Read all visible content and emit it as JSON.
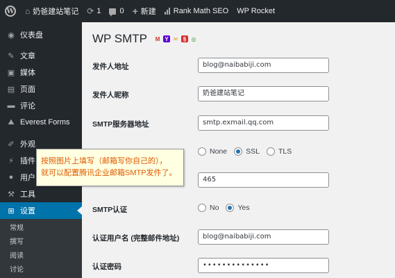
{
  "adminbar": {
    "site_name": "奶爸建站笔记",
    "updates_count": "1",
    "comments_count": "0",
    "new_label": "新建",
    "rank_math": "Rank Math SEO",
    "wp_rocket": "WP Rocket"
  },
  "sidebar": {
    "items": [
      {
        "label": "仪表盘",
        "icon": "dashboard-icon"
      },
      {
        "label": "文章",
        "icon": "pin-icon"
      },
      {
        "label": "媒体",
        "icon": "media-icon"
      },
      {
        "label": "页面",
        "icon": "page-icon"
      },
      {
        "label": "评论",
        "icon": "comment-icon"
      },
      {
        "label": "Everest Forms",
        "icon": "everest-icon"
      },
      {
        "label": "外观",
        "icon": "brush-icon"
      },
      {
        "label": "插件",
        "icon": "plugin-icon"
      },
      {
        "label": "用户",
        "icon": "user-icon"
      },
      {
        "label": "工具",
        "icon": "wrench-icon"
      },
      {
        "label": "设置",
        "icon": "settings-icon"
      }
    ],
    "submenu": [
      "常规",
      "撰写",
      "阅读",
      "讨论"
    ]
  },
  "page": {
    "title": "WP SMTP",
    "title_icons": [
      "M",
      "Y",
      "✉",
      "§",
      "◎"
    ]
  },
  "form": {
    "from_address_label": "发件人地址",
    "from_address_value": "blog@naibabiji.com",
    "from_name_label": "发件人昵称",
    "from_name_value": "奶爸建站笔记",
    "smtp_host_label": "SMTP服务器地址",
    "smtp_host_value": "smtp.exmail.qq.com",
    "secure_options": [
      "None",
      "SSL",
      "TLS"
    ],
    "secure_selected": "SSL",
    "port_value": "465",
    "auth_label": "SMTP认证",
    "auth_options": [
      "No",
      "Yes"
    ],
    "auth_selected": "Yes",
    "username_label": "认证用户名 (完整邮件地址)",
    "username_value": "blog@naibabiji.com",
    "password_label": "认证密码",
    "password_value": "••••••••••••••"
  },
  "tooltip": {
    "line1": "按照图片上填写（邮箱写你自己的），",
    "line2": "就可以配置腾讯企业邮箱SMTP发件了。"
  },
  "colors": {
    "adminbar_bg": "#23282d",
    "active_menu": "#0073aa",
    "radio_checked": "#2271b1",
    "tooltip_text": "#e05a00",
    "tooltip_bg": "#ffffe1"
  }
}
